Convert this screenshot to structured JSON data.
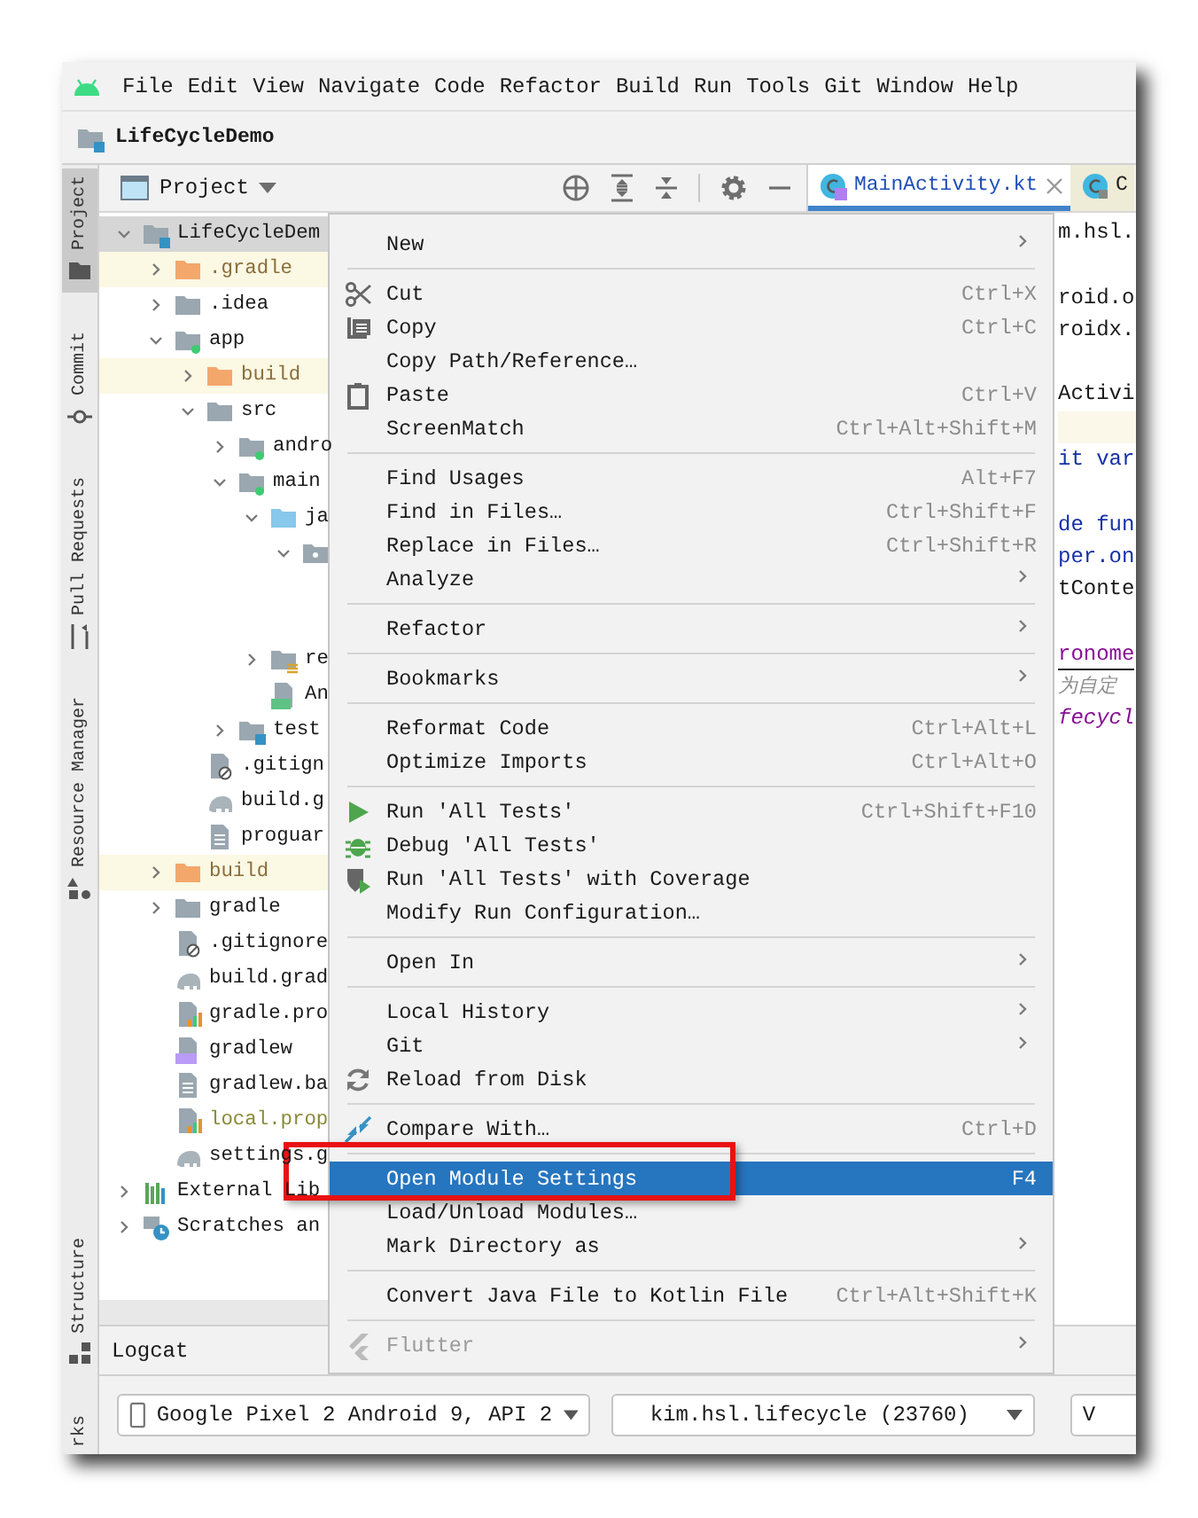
{
  "menubar": {
    "items": [
      "File",
      "Edit",
      "View",
      "Navigate",
      "Code",
      "Refactor",
      "Build",
      "Run",
      "Tools",
      "Git",
      "Window",
      "Help"
    ]
  },
  "navbar": {
    "project": "LifeCycleDemo"
  },
  "tool_strip": {
    "top": [
      {
        "label": "Project",
        "selected": true
      },
      {
        "label": "Commit",
        "selected": false
      },
      {
        "label": "Pull Requests",
        "selected": false
      },
      {
        "label": "Resource Manager",
        "selected": false
      }
    ],
    "bottom": [
      {
        "label": "Structure",
        "selected": false
      },
      {
        "label": "rks",
        "selected": false
      }
    ]
  },
  "project_panel": {
    "view": "Project",
    "tree": [
      {
        "label": "LifeCycleDem",
        "kind": "module",
        "expanded": true,
        "selected": true,
        "ignored": false,
        "children": [
          {
            "label": ".gradle",
            "kind": "excluded",
            "expanded": false,
            "selected": false,
            "ignored": false
          },
          {
            "label": ".idea",
            "kind": "folder",
            "expanded": false,
            "selected": false,
            "ignored": false
          },
          {
            "label": "app",
            "kind": "android",
            "expanded": true,
            "selected": false,
            "ignored": false,
            "children": [
              {
                "label": "build",
                "kind": "excluded",
                "expanded": false,
                "selected": false,
                "ignored": false
              },
              {
                "label": "src",
                "kind": "folder",
                "expanded": true,
                "selected": false,
                "ignored": false,
                "children": [
                  {
                    "label": "andro",
                    "kind": "android",
                    "expanded": false,
                    "selected": false,
                    "ignored": false
                  },
                  {
                    "label": "main",
                    "kind": "android",
                    "expanded": true,
                    "selected": false,
                    "ignored": false,
                    "children": [
                      {
                        "label": "ja",
                        "kind": "source",
                        "expanded": true,
                        "selected": false,
                        "ignored": false,
                        "children": [
                          {
                            "kind": "package",
                            "expanded": true,
                            "selected": false,
                            "children": [
                              {
                                "kind": "covered"
                              },
                              {
                                "kind": "covered"
                              }
                            ]
                          }
                        ]
                      },
                      {
                        "label": "re",
                        "kind": "res",
                        "expanded": false,
                        "selected": false,
                        "ignored": false
                      },
                      {
                        "label": "An",
                        "kind": "manifest",
                        "selected": false,
                        "ignored": false
                      }
                    ]
                  },
                  {
                    "label": "test",
                    "kind": "test",
                    "expanded": false,
                    "selected": false,
                    "ignored": false
                  }
                ]
              },
              {
                "label": ".gitign",
                "kind": "ignorefile",
                "selected": false,
                "ignored": false
              },
              {
                "label": "build.g",
                "kind": "gradle",
                "selected": false,
                "ignored": false
              },
              {
                "label": "proguar",
                "kind": "text",
                "selected": false,
                "ignored": false
              }
            ]
          },
          {
            "label": "build",
            "kind": "excluded",
            "expanded": false,
            "selected": false,
            "ignored": false
          },
          {
            "label": "gradle",
            "kind": "folder",
            "expanded": false,
            "selected": false,
            "ignored": false
          },
          {
            "label": ".gitignore",
            "kind": "ignorefile",
            "selected": false,
            "ignored": false
          },
          {
            "label": "build.grad",
            "kind": "gradle",
            "selected": false,
            "ignored": false
          },
          {
            "label": "gradle.pro",
            "kind": "props",
            "selected": false,
            "ignored": false
          },
          {
            "label": "gradlew",
            "kind": "script",
            "selected": false,
            "ignored": false
          },
          {
            "label": "gradlew.ba",
            "kind": "text",
            "selected": false,
            "ignored": false
          },
          {
            "label": "local.prop",
            "kind": "props",
            "selected": false,
            "ignored": true
          },
          {
            "label": "settings.g",
            "kind": "gradle",
            "selected": false,
            "ignored": false
          }
        ]
      },
      {
        "label": "External Lib",
        "kind": "library",
        "expanded": false,
        "selected": false,
        "ignored": false
      },
      {
        "label": "Scratches an",
        "kind": "scratches",
        "expanded": false,
        "selected": false,
        "ignored": false
      }
    ]
  },
  "editor": {
    "tabs": [
      {
        "label": "MainActivity.kt",
        "selected": true
      },
      {
        "label": "C",
        "selected": false
      }
    ],
    "lines": [
      {
        "text": "m.hsl.",
        "kind": "plain",
        "current": false
      },
      {
        "kind": "blank"
      },
      {
        "text": "roid.o",
        "kind": "plain",
        "current": false
      },
      {
        "text": "roidx.",
        "kind": "plain",
        "current": false
      },
      {
        "kind": "blank"
      },
      {
        "text": "Activi",
        "kind": "plain",
        "current": false
      },
      {
        "kind": "blank",
        "current": true
      },
      {
        "text": "it var",
        "kind": "keyword",
        "current": false
      },
      {
        "kind": "blank"
      },
      {
        "text": "de fun",
        "kind": "keyword",
        "current": false
      },
      {
        "text": "per.on",
        "kind": "keyword",
        "current": false
      },
      {
        "text": "tConte",
        "kind": "plain",
        "current": false
      },
      {
        "kind": "blank"
      },
      {
        "text": "ronome",
        "kind": "member",
        "current": false
      },
      {
        "text": "为自定",
        "kind": "comment",
        "current": false
      },
      {
        "text": "fecycl",
        "kind": "italic",
        "current": false
      }
    ]
  },
  "logcat": {
    "title": "Logcat"
  },
  "run_bar": {
    "device": "Google Pixel 2 Android 9, API 2",
    "process": "kim.hsl.lifecycle (23760)",
    "filter": "V"
  },
  "context_menu": {
    "items": [
      {
        "kind": "plain",
        "label": "New",
        "submenu": true,
        "selected": false,
        "disabled": false
      },
      {
        "kind": "separator"
      },
      {
        "kind": "cut",
        "label": "Cut",
        "shortcut": "Ctrl+X",
        "submenu": false,
        "selected": false,
        "disabled": false
      },
      {
        "kind": "copy",
        "label": "Copy",
        "shortcut": "Ctrl+C",
        "submenu": false,
        "selected": false,
        "disabled": false
      },
      {
        "kind": "plain",
        "label": "Copy Path/Reference…",
        "submenu": false,
        "selected": false,
        "disabled": false
      },
      {
        "kind": "paste",
        "label": "Paste",
        "shortcut": "Ctrl+V",
        "submenu": false,
        "selected": false,
        "disabled": false
      },
      {
        "kind": "plain",
        "label": "ScreenMatch",
        "shortcut": "Ctrl+Alt+Shift+M",
        "submenu": false,
        "selected": false,
        "disabled": false
      },
      {
        "kind": "separator"
      },
      {
        "kind": "plain",
        "label": "Find Usages",
        "shortcut": "Alt+F7",
        "submenu": false,
        "selected": false,
        "disabled": false
      },
      {
        "kind": "plain",
        "label": "Find in Files…",
        "shortcut": "Ctrl+Shift+F",
        "submenu": false,
        "selected": false,
        "disabled": false
      },
      {
        "kind": "plain",
        "label": "Replace in Files…",
        "shortcut": "Ctrl+Shift+R",
        "submenu": false,
        "selected": false,
        "disabled": false
      },
      {
        "kind": "plain",
        "label": "Analyze",
        "submenu": true,
        "selected": false,
        "disabled": false
      },
      {
        "kind": "separator"
      },
      {
        "kind": "plain",
        "label": "Refactor",
        "submenu": true,
        "selected": false,
        "disabled": false
      },
      {
        "kind": "separator"
      },
      {
        "kind": "plain",
        "label": "Bookmarks",
        "submenu": true,
        "selected": false,
        "disabled": false
      },
      {
        "kind": "separator"
      },
      {
        "kind": "plain",
        "label": "Reformat Code",
        "shortcut": "Ctrl+Alt+L",
        "submenu": false,
        "selected": false,
        "disabled": false
      },
      {
        "kind": "plain",
        "label": "Optimize Imports",
        "shortcut": "Ctrl+Alt+O",
        "submenu": false,
        "selected": false,
        "disabled": false
      },
      {
        "kind": "separator"
      },
      {
        "kind": "run",
        "label": "Run 'All Tests'",
        "shortcut": "Ctrl+Shift+F10",
        "submenu": false,
        "selected": false,
        "disabled": false
      },
      {
        "kind": "debug",
        "label": "Debug 'All Tests'",
        "submenu": false,
        "selected": false,
        "disabled": false
      },
      {
        "kind": "coverage",
        "label": "Run 'All Tests' with Coverage",
        "submenu": false,
        "selected": false,
        "disabled": false
      },
      {
        "kind": "plain",
        "label": "Modify Run Configuration…",
        "submenu": false,
        "selected": false,
        "disabled": false
      },
      {
        "kind": "separator"
      },
      {
        "kind": "plain",
        "label": "Open In",
        "submenu": true,
        "selected": false,
        "disabled": false
      },
      {
        "kind": "separator"
      },
      {
        "kind": "plain",
        "label": "Local History",
        "submenu": true,
        "selected": false,
        "disabled": false
      },
      {
        "kind": "plain",
        "label": "Git",
        "submenu": true,
        "selected": false,
        "disabled": false
      },
      {
        "kind": "reload",
        "label": "Reload from Disk",
        "submenu": false,
        "selected": false,
        "disabled": false
      },
      {
        "kind": "separator"
      },
      {
        "kind": "compare",
        "label": "Compare With…",
        "shortcut": "Ctrl+D",
        "submenu": false,
        "selected": false,
        "disabled": false
      },
      {
        "kind": "separator"
      },
      {
        "kind": "plain",
        "label": "Open Module Settings",
        "shortcut": "F4",
        "submenu": false,
        "selected": true,
        "disabled": false
      },
      {
        "kind": "plain",
        "label": "Load/Unload Modules…",
        "submenu": false,
        "selected": false,
        "disabled": false
      },
      {
        "kind": "plain",
        "label": "Mark Directory as",
        "submenu": true,
        "selected": false,
        "disabled": false
      },
      {
        "kind": "separator"
      },
      {
        "kind": "plain",
        "label": "Convert Java File to Kotlin File",
        "shortcut": "Ctrl+Alt+Shift+K",
        "submenu": false,
        "selected": false,
        "disabled": false
      },
      {
        "kind": "separator"
      },
      {
        "kind": "flutter",
        "label": "Flutter",
        "submenu": true,
        "selected": false,
        "disabled": true
      }
    ]
  }
}
